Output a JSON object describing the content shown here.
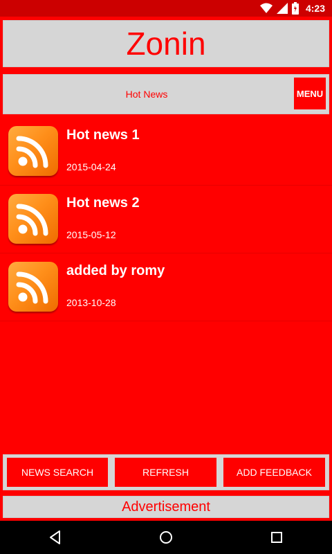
{
  "status_bar": {
    "time": "4:23",
    "icons": [
      "wifi-icon",
      "signal-icon",
      "battery-icon"
    ]
  },
  "app": {
    "title": "Zonin",
    "section_title": "Hot News",
    "menu_label": "MENU"
  },
  "news": [
    {
      "title": "Hot news 1",
      "date": "2015-04-24",
      "icon": "rss-icon"
    },
    {
      "title": "Hot news 2",
      "date": "2015-05-12",
      "icon": "rss-icon"
    },
    {
      "title": "added by romy",
      "date": "2013-10-28",
      "icon": "rss-icon"
    }
  ],
  "bottom_buttons": {
    "search": "NEWS SEARCH",
    "refresh": "REFRESH",
    "feedback": "ADD FEEDBACK"
  },
  "ad_label": "Advertisement",
  "navigation": [
    "back-icon",
    "home-icon",
    "recents-icon"
  ],
  "colors": {
    "primary": "#ff0000",
    "panel": "#d6d6d6",
    "status_bar": "#cc0000",
    "icon_orange": "#ff8f1a"
  }
}
